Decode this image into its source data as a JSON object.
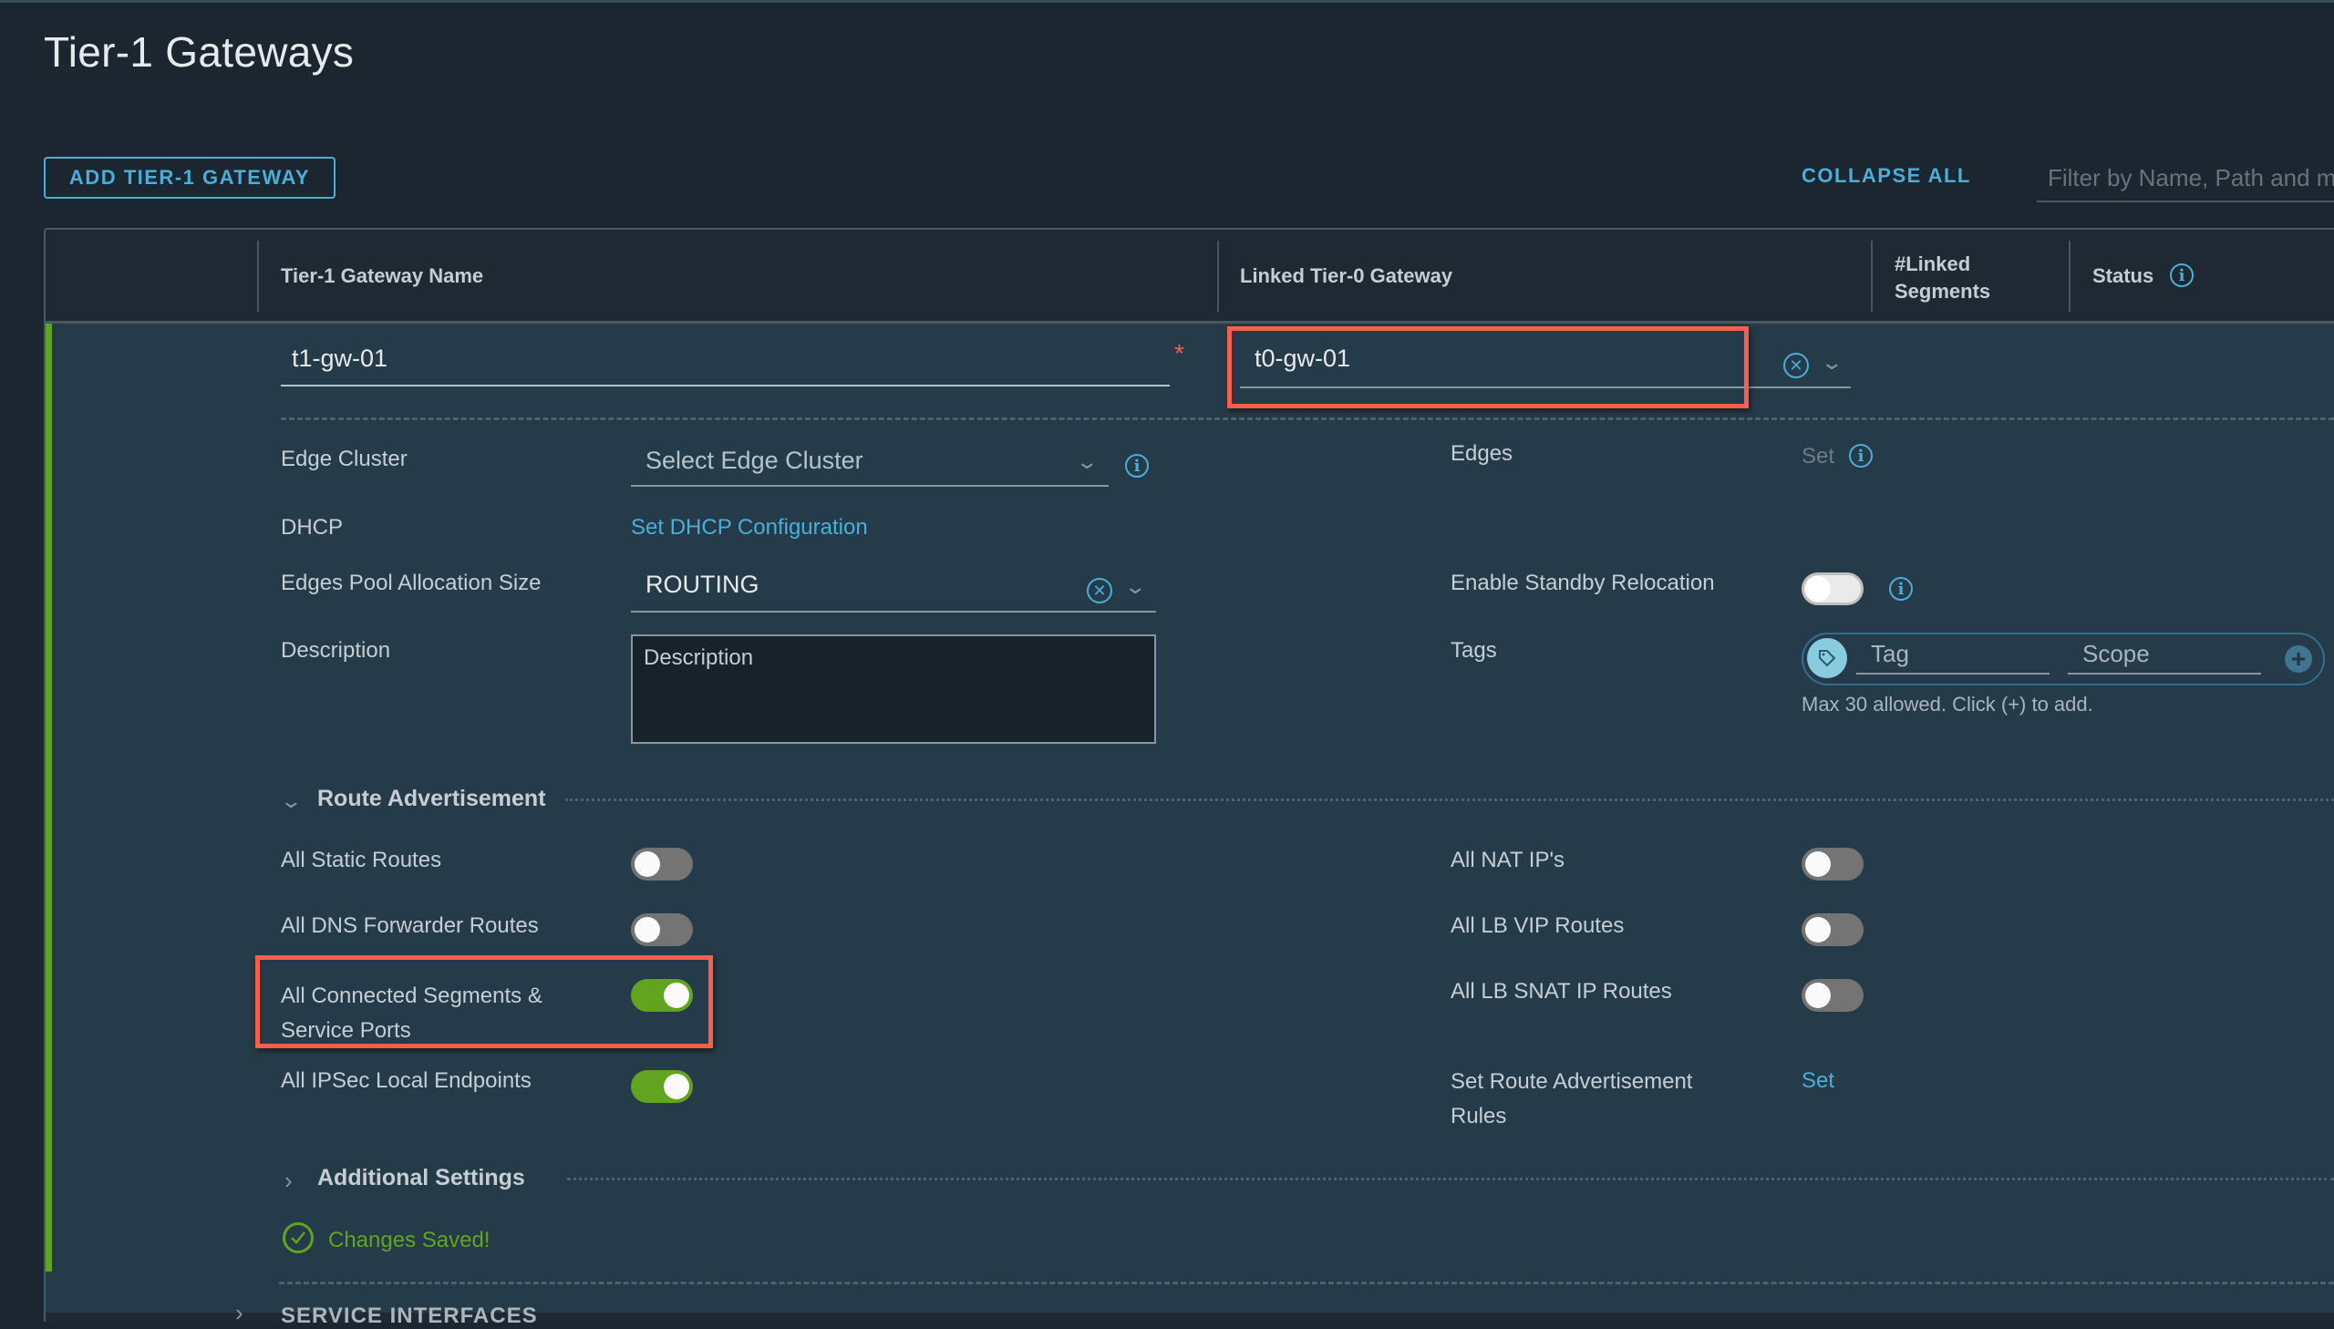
{
  "page": {
    "title": "Tier-1 Gateways",
    "add_button": "ADD TIER-1 GATEWAY",
    "collapse_all": "COLLAPSE ALL",
    "filter_placeholder": "Filter by Name, Path and more"
  },
  "table": {
    "columns": [
      {
        "label": "Tier-1 Gateway Name"
      },
      {
        "label": "Linked Tier-0 Gateway"
      },
      {
        "label": "#Linked Segments"
      },
      {
        "label": "Status"
      }
    ],
    "columns_linked_line1": "#Linked",
    "columns_linked_line2": "Segments"
  },
  "row": {
    "name_value": "t1-gw-01",
    "required_marker": "*",
    "linked_t0_value": "t0-gw-01",
    "left_fields": {
      "edge_cluster_label": "Edge Cluster",
      "edge_cluster_placeholder": "Select Edge Cluster",
      "dhcp_label": "DHCP",
      "dhcp_link": "Set DHCP Configuration",
      "pool_size_label": "Edges Pool Allocation Size",
      "pool_size_value": "ROUTING",
      "description_label": "Description",
      "description_placeholder": "Description"
    },
    "right_fields": {
      "edges_label": "Edges",
      "edges_set": "Set",
      "standby_label": "Enable Standby Relocation",
      "standby_enabled": false,
      "tags_label": "Tags",
      "tag_placeholder": "Tag",
      "scope_placeholder": "Scope",
      "tags_hint": "Max 30 allowed. Click (+) to add."
    },
    "route_advertisement": {
      "title": "Route Advertisement",
      "expanded": true,
      "left": [
        {
          "label": "All Static Routes",
          "enabled": false
        },
        {
          "label": "All DNS Forwarder Routes",
          "enabled": false
        },
        {
          "label_line1": "All Connected Segments &",
          "label_line2": "Service Ports",
          "enabled": true,
          "highlighted": true
        },
        {
          "label": "All IPSec Local Endpoints",
          "enabled": true
        }
      ],
      "right": [
        {
          "label": "All NAT IP's",
          "enabled": false
        },
        {
          "label": "All LB VIP Routes",
          "enabled": false
        },
        {
          "label": "All LB SNAT IP Routes",
          "enabled": false
        }
      ],
      "rules_label_line1": "Set Route Advertisement",
      "rules_label_line2": "Rules",
      "rules_link": "Set"
    },
    "additional_settings": {
      "title": "Additional Settings",
      "expanded": false
    },
    "status_message": "Changes Saved!",
    "next_section": "SERVICE INTERFACES"
  },
  "colors": {
    "accent": "#49afd9",
    "success": "#62a420",
    "highlight": "#f55f4b",
    "background": "#1b2630",
    "row_background": "#263b49"
  }
}
